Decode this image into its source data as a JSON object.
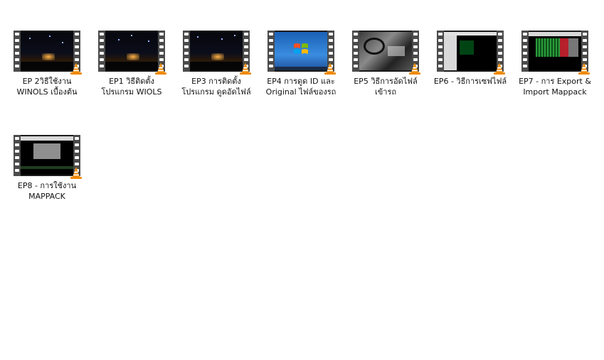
{
  "items": [
    {
      "label": "EP 2วิธีใช้งาน WINOLS เบื้องต้น",
      "thumb": "night-sky"
    },
    {
      "label": "EP1 วิธีติดตั้งโปรแกรม WIOLS",
      "thumb": "night-sky"
    },
    {
      "label": "EP3 การติดตั้งโปรแกรม ดูดอัดไฟล์",
      "thumb": "night-sky"
    },
    {
      "label": "EP4 การดูด ID และ Original ไฟล์ของรถ",
      "thumb": "windows-desktop"
    },
    {
      "label": "EP5 วิธีการอัดไฟล์เข้ารถ",
      "thumb": "car-interior"
    },
    {
      "label": "EP6 - วิธีการเซฟไฟล์",
      "thumb": "terminal-window"
    },
    {
      "label": "EP7 - การ Export & Import Mappack",
      "thumb": "hex-editor"
    },
    {
      "label": "EP8 - การใช้งาน MAPPACK",
      "thumb": "mappack-window"
    }
  ],
  "icons": {
    "file_type": "vlc-cone-icon",
    "film_strip": "film-strip-icon"
  },
  "colors": {
    "cone_orange": "#f08a00",
    "cone_white": "#ffffff",
    "film": "#4b4b4b"
  }
}
